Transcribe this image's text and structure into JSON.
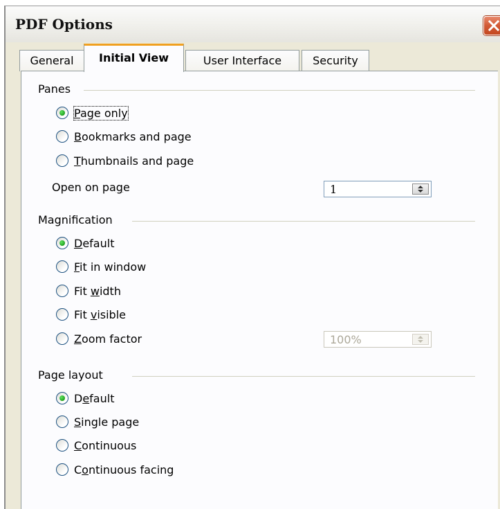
{
  "window": {
    "title": "PDF Options"
  },
  "tabs": [
    {
      "label": "General"
    },
    {
      "label": "Initial View"
    },
    {
      "label": "User Interface"
    },
    {
      "label": "Security"
    }
  ],
  "panes": {
    "label": "Panes",
    "options": [
      {
        "pre": "",
        "mnemonic": "P",
        "post": "age only",
        "checked": true
      },
      {
        "pre": "",
        "mnemonic": "B",
        "post": "ookmarks and page",
        "checked": false
      },
      {
        "pre": "",
        "mnemonic": "T",
        "post": "humbnails and page",
        "checked": false
      }
    ],
    "open_on_page": {
      "pre": "Open on pa",
      "mnemonic": "g",
      "post": "e",
      "value": "1"
    }
  },
  "magnification": {
    "label": "Magnification",
    "options": [
      {
        "pre": "",
        "mnemonic": "D",
        "post": "efault",
        "checked": true
      },
      {
        "pre": "",
        "mnemonic": "F",
        "post": "it in window",
        "checked": false
      },
      {
        "pre": "Fit ",
        "mnemonic": "w",
        "post": "idth",
        "checked": false
      },
      {
        "pre": "Fit ",
        "mnemonic": "v",
        "post": "isible",
        "checked": false
      },
      {
        "pre": "",
        "mnemonic": "Z",
        "post": "oom factor",
        "checked": false
      }
    ],
    "zoom_value": "100%"
  },
  "page_layout": {
    "label": "Page layout",
    "options": [
      {
        "pre": "D",
        "mnemonic": "e",
        "post": "fault",
        "checked": true
      },
      {
        "pre": "",
        "mnemonic": "S",
        "post": "ingle page",
        "checked": false
      },
      {
        "pre": "",
        "mnemonic": "C",
        "post": "ontinuous",
        "checked": false
      },
      {
        "pre": "C",
        "mnemonic": "o",
        "post": "ntinuous facing",
        "checked": false
      }
    ]
  },
  "colors": {
    "dialog_bg": "#ece9d8",
    "panel_bg": "#fcfcfe",
    "active_tab_accent": "#f0a020",
    "close_button": "#d25a36",
    "radio_dot": "#21a121"
  }
}
